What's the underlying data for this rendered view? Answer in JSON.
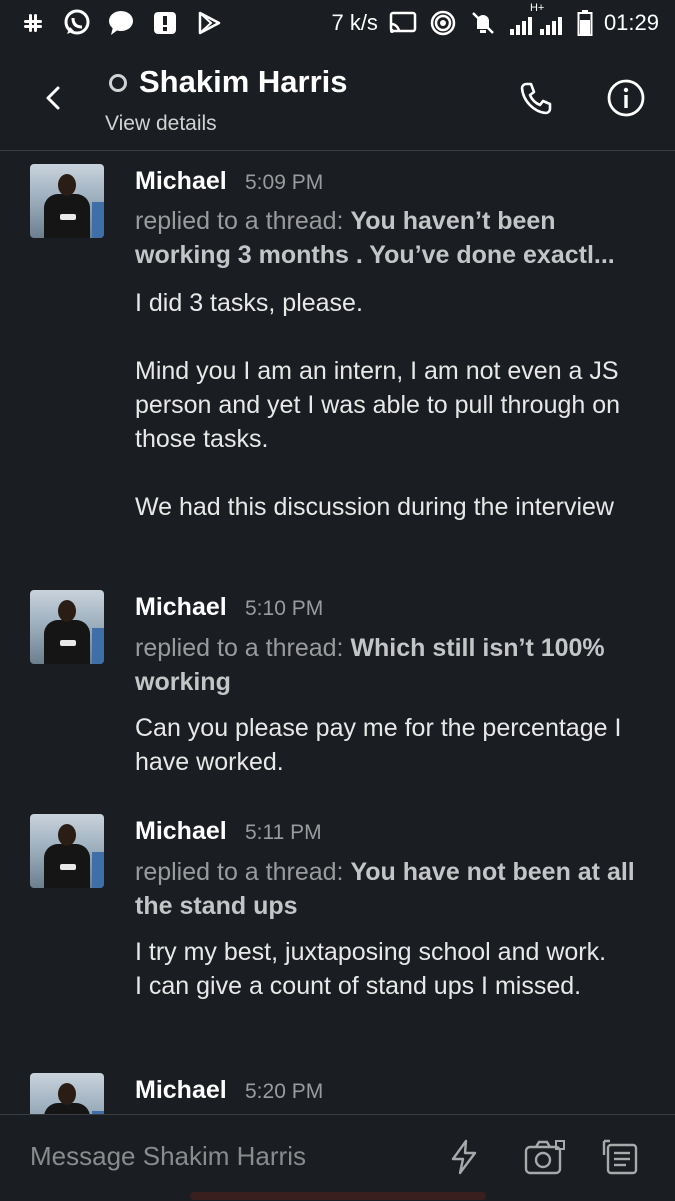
{
  "status_bar": {
    "speed": "7 k/s",
    "time": "01:29",
    "network_type": "H+",
    "left_icons": [
      "slack-icon",
      "whatsapp-icon",
      "chat-bubble-icon",
      "alert-icon",
      "play-store-icon"
    ]
  },
  "header": {
    "title": "Shakim Harris",
    "subtitle": "View details"
  },
  "messages": [
    {
      "author": "Michael",
      "time": "5:09 PM",
      "thread_prefix": "replied to a thread:",
      "thread_text": "You haven’t been working 3 months . You’ve done exactl...",
      "body": "I did 3 tasks, please.\n\nMind you I am an intern, I am not even a JS person and yet I was able to pull through on those tasks.\n\nWe had this discussion during the interview"
    },
    {
      "author": "Michael",
      "time": "5:10 PM",
      "thread_prefix": "replied to a thread:",
      "thread_text": "Which still isn’t 100% working",
      "body": "Can you please pay me for the percentage I have worked."
    },
    {
      "author": "Michael",
      "time": "5:11 PM",
      "thread_prefix": "replied to a thread:",
      "thread_text": "You have not been at all the stand ups",
      "body": "I try my best, juxtaposing school and work.\nI can give a count of stand ups I missed."
    },
    {
      "author": "Michael",
      "time": "5:20 PM"
    }
  ],
  "composer": {
    "placeholder": "Message Shakim Harris"
  },
  "colors": {
    "background": "#1a1d21",
    "text": "#e8e8e8",
    "muted": "#9a9b9d"
  }
}
